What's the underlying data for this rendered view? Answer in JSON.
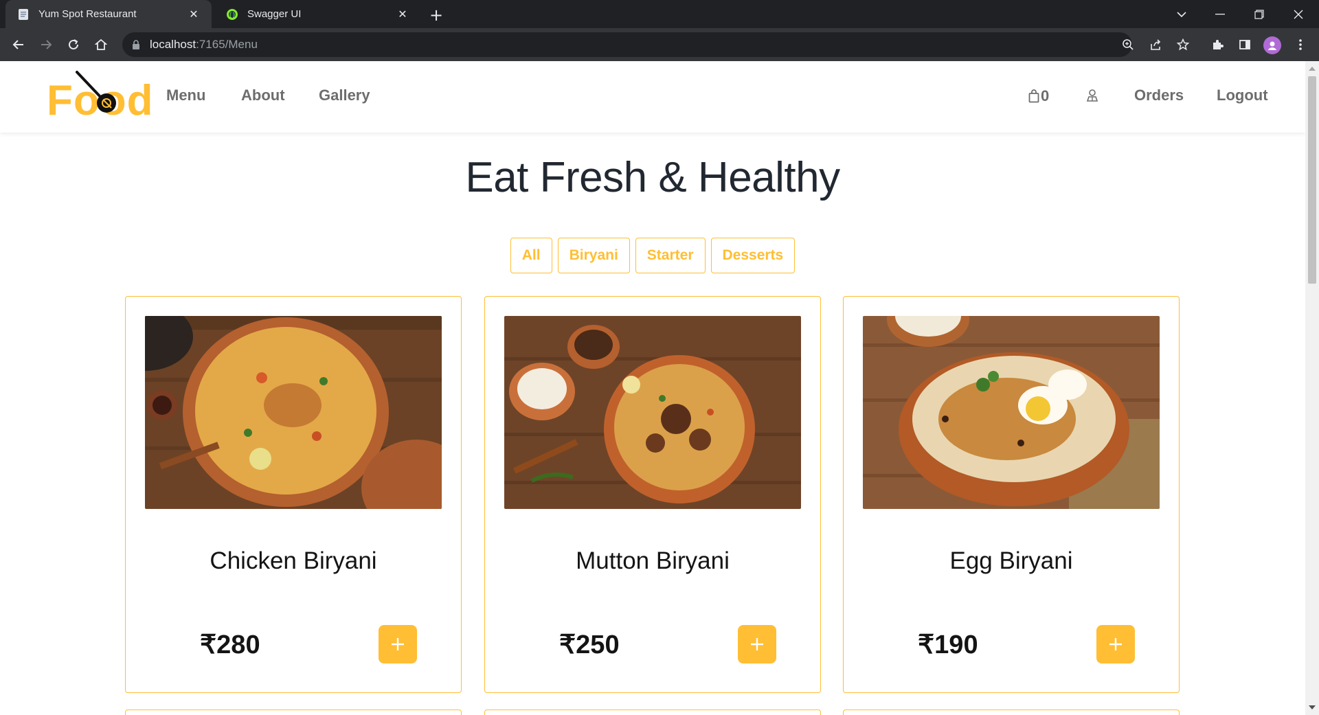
{
  "browser": {
    "tabs": [
      {
        "title": "Yum Spot Restaurant",
        "active": true
      },
      {
        "title": "Swagger UI",
        "active": false
      }
    ],
    "url_host": "localhost",
    "url_path": ":7165/Menu"
  },
  "header": {
    "logo_text": "Food",
    "nav": [
      "Menu",
      "About",
      "Gallery"
    ],
    "cart_count": "0",
    "orders_label": "Orders",
    "logout_label": "Logout"
  },
  "hero": {
    "heading": "Eat Fresh & Healthy"
  },
  "filters": [
    "All",
    "Biryani",
    "Starter",
    "Desserts"
  ],
  "products": [
    {
      "name": "Chicken Biryani",
      "price": "₹280",
      "dish": "chicken-biryani"
    },
    {
      "name": "Mutton Biryani",
      "price": "₹250",
      "dish": "mutton-biryani"
    },
    {
      "name": "Egg Biryani",
      "price": "₹190",
      "dish": "egg-biryani"
    }
  ],
  "colors": {
    "brand": "#ffbe33",
    "heading": "#222831",
    "nav_text": "#6d6d6d"
  }
}
